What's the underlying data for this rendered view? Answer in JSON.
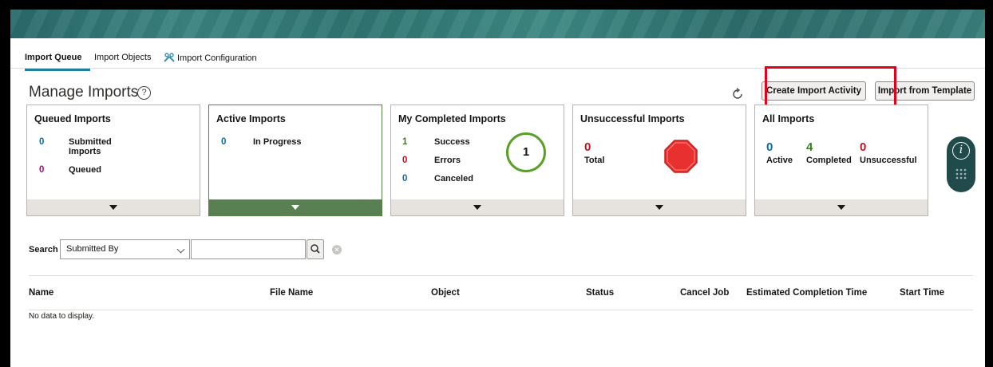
{
  "tabs": [
    {
      "label": "Import Queue",
      "active": true
    },
    {
      "label": "Import Objects",
      "active": false
    },
    {
      "label": "Import Configuration",
      "active": false,
      "icon": "tools-icon"
    }
  ],
  "page": {
    "title": "Manage Imports"
  },
  "actions": {
    "create_label": "Create Import Activity",
    "template_label": "Import from Template"
  },
  "cards": {
    "queued": {
      "title": "Queued Imports",
      "submitted_count": "0",
      "submitted_label": "Submitted Imports",
      "queued_count": "0",
      "queued_label": "Queued"
    },
    "active": {
      "title": "Active Imports",
      "progress_count": "0",
      "progress_label": "In Progress"
    },
    "completed": {
      "title": "My Completed Imports",
      "success_count": "1",
      "success_label": "Success",
      "errors_count": "0",
      "errors_label": "Errors",
      "canceled_count": "0",
      "canceled_label": "Canceled",
      "circle_value": "1"
    },
    "unsuccessful": {
      "title": "Unsuccessful Imports",
      "total_count": "0",
      "total_label": "Total"
    },
    "all": {
      "title": "All Imports",
      "active_count": "0",
      "active_label": "Active",
      "completed_count": "4",
      "completed_label": "Completed",
      "unsuccessful_count": "0",
      "unsuccessful_label": "Unsuccessful"
    }
  },
  "search": {
    "label": "Search",
    "field_value": "Submitted By",
    "placeholder": ""
  },
  "table": {
    "columns": [
      "Name",
      "File Name",
      "Object",
      "Status",
      "Cancel Job",
      "Estimated Completion Time",
      "Start Time"
    ],
    "empty_text": "No data to display."
  },
  "colors": {
    "accent": "#227e9e",
    "success": "#5aa028",
    "error": "#c1121f",
    "count_blue": "#0b6ba8",
    "queued_magenta": "#a1136b",
    "highlight": "#e2001a"
  }
}
